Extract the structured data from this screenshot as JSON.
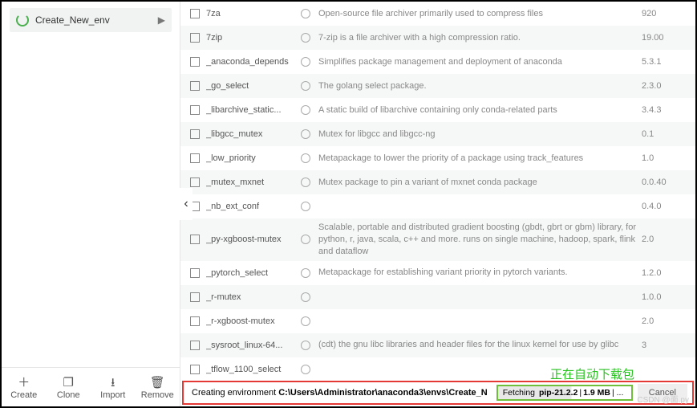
{
  "sidebar": {
    "env_name": "Create_New_env",
    "actions": [
      {
        "icon": "＋",
        "label": "Create"
      },
      {
        "icon": "❐",
        "label": "Clone"
      },
      {
        "icon": "⭳",
        "label": "Import"
      },
      {
        "icon": "🗑",
        "label": "Remove"
      }
    ]
  },
  "packages": [
    {
      "name": "7za",
      "desc": "Open-source file archiver primarily used to compress files",
      "version": "920"
    },
    {
      "name": "7zip",
      "desc": "7-zip is a file archiver with a high compression ratio.",
      "version": "19.00"
    },
    {
      "name": "_anaconda_depends",
      "desc": "Simplifies package management and deployment of anaconda",
      "version": "5.3.1"
    },
    {
      "name": "_go_select",
      "desc": "The golang select package.",
      "version": "2.3.0"
    },
    {
      "name": "_libarchive_static...",
      "desc": "A static build of libarchive containing only conda-related parts",
      "version": "3.4.3"
    },
    {
      "name": "_libgcc_mutex",
      "desc": "Mutex for libgcc and libgcc-ng",
      "version": "0.1"
    },
    {
      "name": "_low_priority",
      "desc": "Metapackage to lower the priority of a package using track_features",
      "version": "1.0"
    },
    {
      "name": "_mutex_mxnet",
      "desc": "Mutex package to pin a variant of mxnet conda package",
      "version": "0.0.40"
    },
    {
      "name": "_nb_ext_conf",
      "desc": "",
      "version": "0.4.0"
    },
    {
      "name": "_py-xgboost-mutex",
      "desc": "Scalable, portable and distributed gradient boosting (gbdt, gbrt or gbm) library, for python, r, java, scala, c++ and more. runs on single machine, hadoop, spark, flink and dataflow",
      "version": "2.0"
    },
    {
      "name": "_pytorch_select",
      "desc": "Metapackage for establishing variant priority in pytorch variants.",
      "version": "1.2.0"
    },
    {
      "name": "_r-mutex",
      "desc": "",
      "version": "1.0.0"
    },
    {
      "name": "_r-xgboost-mutex",
      "desc": "",
      "version": "2.0"
    },
    {
      "name": "_sysroot_linux-64...",
      "desc": "(cdt) the gnu libc libraries and header files for the linux kernel for use by glibc",
      "version": "3"
    },
    {
      "name": "_tflow_1100_select",
      "desc": "",
      "version": ""
    }
  ],
  "annotation": "正在自动下载包",
  "status": {
    "creating_label": "Creating environment",
    "path": "C:\\Users\\Administrator\\anaconda3\\envs\\Create_N",
    "fetch_prefix": "Fetching",
    "fetch_pkg": "pip-21.2.2",
    "fetch_sep": " | ",
    "fetch_size": "1.9 MB",
    "fetch_tail": " | ...",
    "cancel": "Cancel"
  },
  "watermark": "CSDN @面.py"
}
